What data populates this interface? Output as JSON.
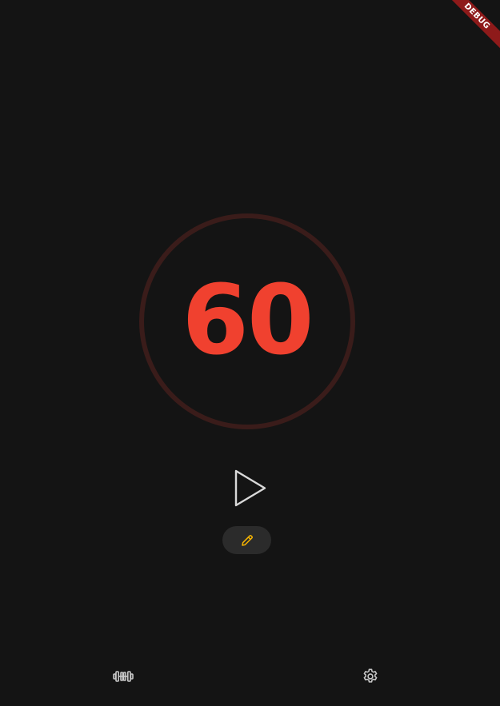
{
  "debug_banner": {
    "label": "DEBUG",
    "color": "#8e1a1a"
  },
  "timer": {
    "value": "60",
    "text_color": "#f0412f",
    "ring_color": "#3a1c1a"
  },
  "controls": {
    "play_icon": "play-icon",
    "edit_icon": "pencil-icon",
    "edit_icon_color": "#f5b301"
  },
  "nav": {
    "items": [
      {
        "icon": "dumbbell-icon"
      },
      {
        "icon": "gear-icon"
      }
    ],
    "icon_color": "#c9c9c9"
  },
  "theme": {
    "background": "#141414"
  }
}
